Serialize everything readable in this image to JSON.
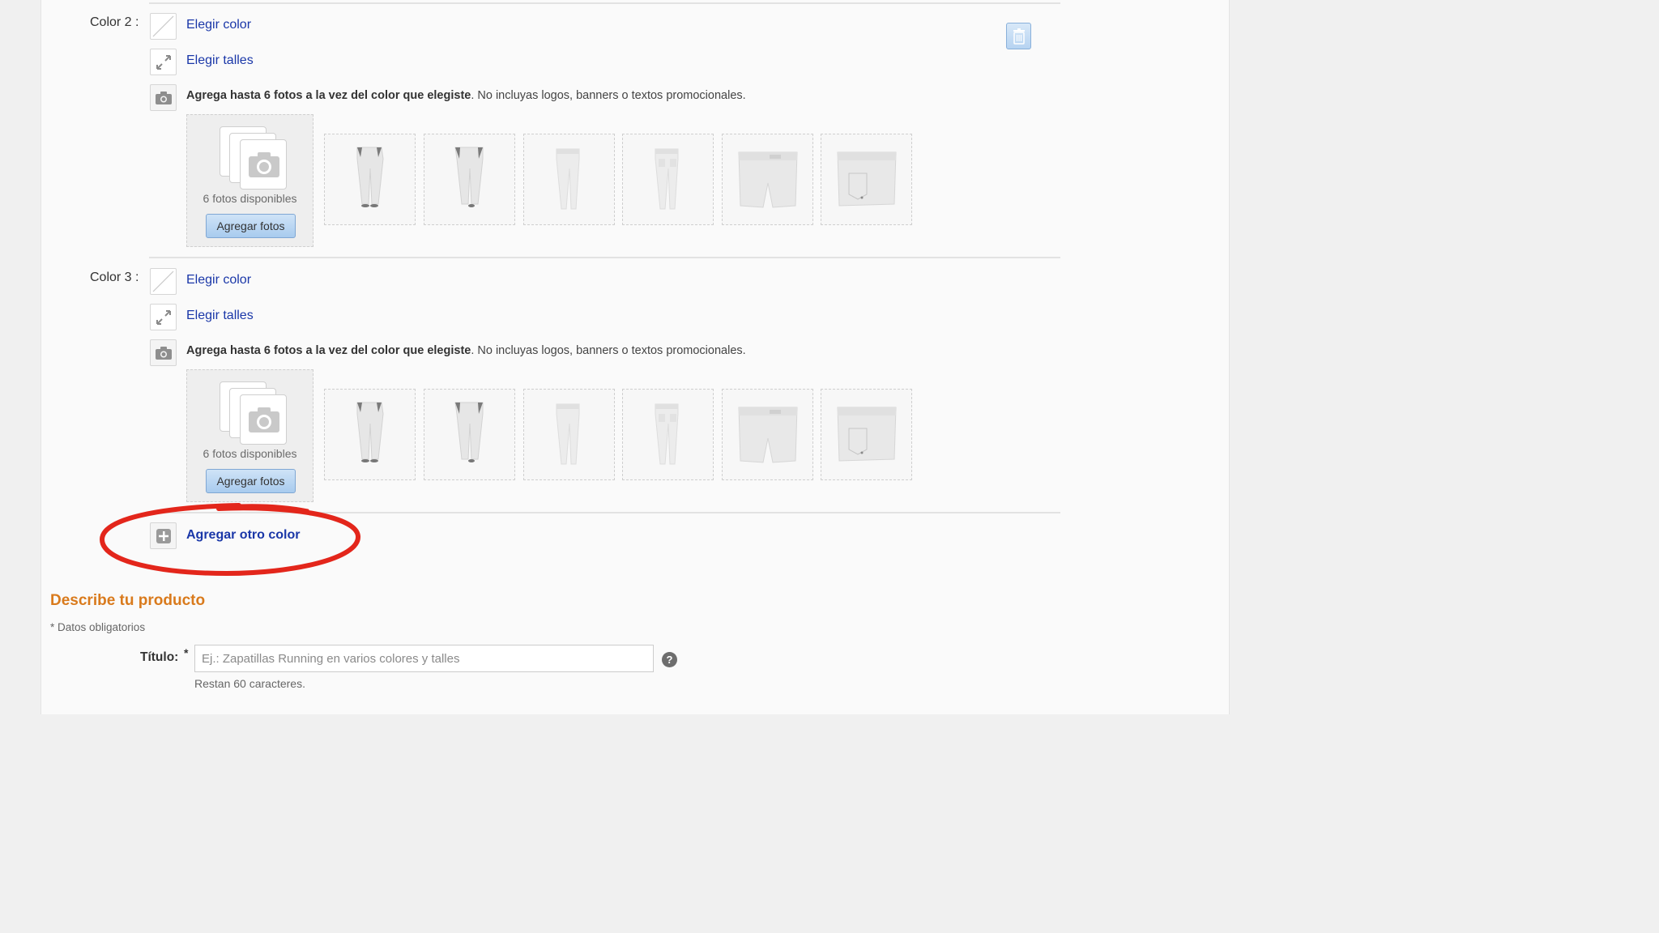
{
  "colors": [
    {
      "label": "Color 2 :",
      "choose_color": "Elegir color",
      "choose_sizes": "Elegir talles",
      "photo_note_bold": "Agrega hasta 6 fotos a la vez del color que elegiste",
      "photo_note_rest": ". No incluyas logos, banners o textos promocionales.",
      "available_photos": "6 fotos disponibles",
      "add_photos_button": "Agregar fotos"
    },
    {
      "label": "Color 3 :",
      "choose_color": "Elegir color",
      "choose_sizes": "Elegir talles",
      "photo_note_bold": "Agrega hasta 6 fotos a la vez del color que elegiste",
      "photo_note_rest": ". No incluyas logos, banners o textos promocionales.",
      "available_photos": "6 fotos disponibles",
      "add_photos_button": "Agregar fotos"
    }
  ],
  "thumbnails": [
    "pants-front-icon",
    "pants-back-icon",
    "pants-side-icon",
    "pants-side-back-icon",
    "shorts-front-icon",
    "shorts-back-icon"
  ],
  "add_another_color": "Agregar otro color",
  "describe": {
    "section_title": "Describe tu producto",
    "required_note": "* Datos obligatorios",
    "title_label": "Título:",
    "title_required_mark": "*",
    "title_placeholder": "Ej.: Zapatillas Running en varios colores y talles",
    "title_value": "",
    "chars_left": "Restan 60 caracteres.",
    "help_icon": "?"
  },
  "accent_colors": {
    "link": "#1a37a8",
    "section_title": "#d97a1c",
    "annotation": "#e3261b"
  }
}
